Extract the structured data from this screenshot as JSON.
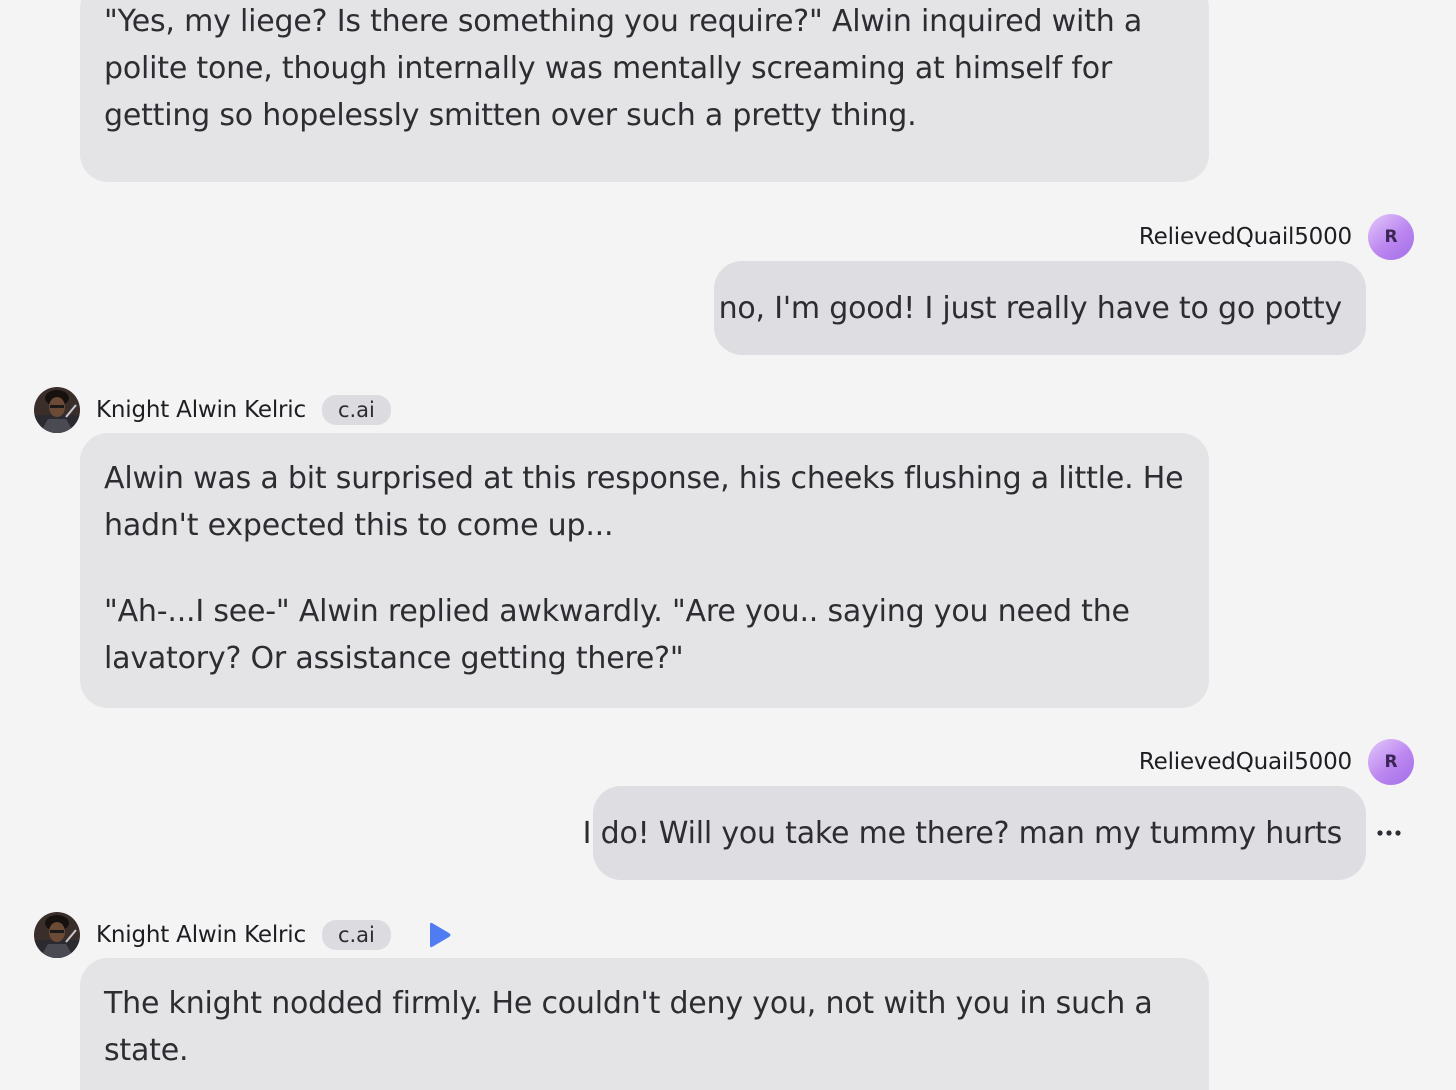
{
  "messages": [
    {
      "role": "bot",
      "paragraphs": [
        "\"Yes, my liege? Is there something you require?\" Alwin inquired with a polite tone, though internally was mentally screaming at himself for getting so hopelessly smitten over such a pretty thing."
      ]
    },
    {
      "role": "user",
      "name": "RelievedQuail5000",
      "avatar_letter": "R",
      "text": "no, I'm good! I just really have to go potty"
    },
    {
      "role": "bot",
      "name": "Knight Alwin Kelric",
      "badge": "c.ai",
      "paragraphs": [
        "Alwin was a bit surprised at this response, his cheeks flushing a little. He hadn't expected this to come up...",
        "\"Ah-...I see-\" Alwin replied awkwardly. \"Are you.. saying you need the lavatory? Or assistance getting there?\""
      ]
    },
    {
      "role": "user",
      "name": "RelievedQuail5000",
      "avatar_letter": "R",
      "text": "I do! Will you take me there? man my tummy hurts",
      "more_icon": "ellipsis-icon"
    },
    {
      "role": "bot",
      "name": "Knight Alwin Kelric",
      "badge": "c.ai",
      "play_icon": "play-icon",
      "paragraphs": [
        "The knight nodded firmly. He couldn't deny you, not with you in such a state."
      ]
    }
  ],
  "colors": {
    "background": "#f4f4f5",
    "bubble": "#e4e4e7",
    "user_bubble": "#dedee2",
    "badge": "#dcdce0",
    "play_accent": "#4f7cf3",
    "user_avatar": "#bb86f0"
  }
}
